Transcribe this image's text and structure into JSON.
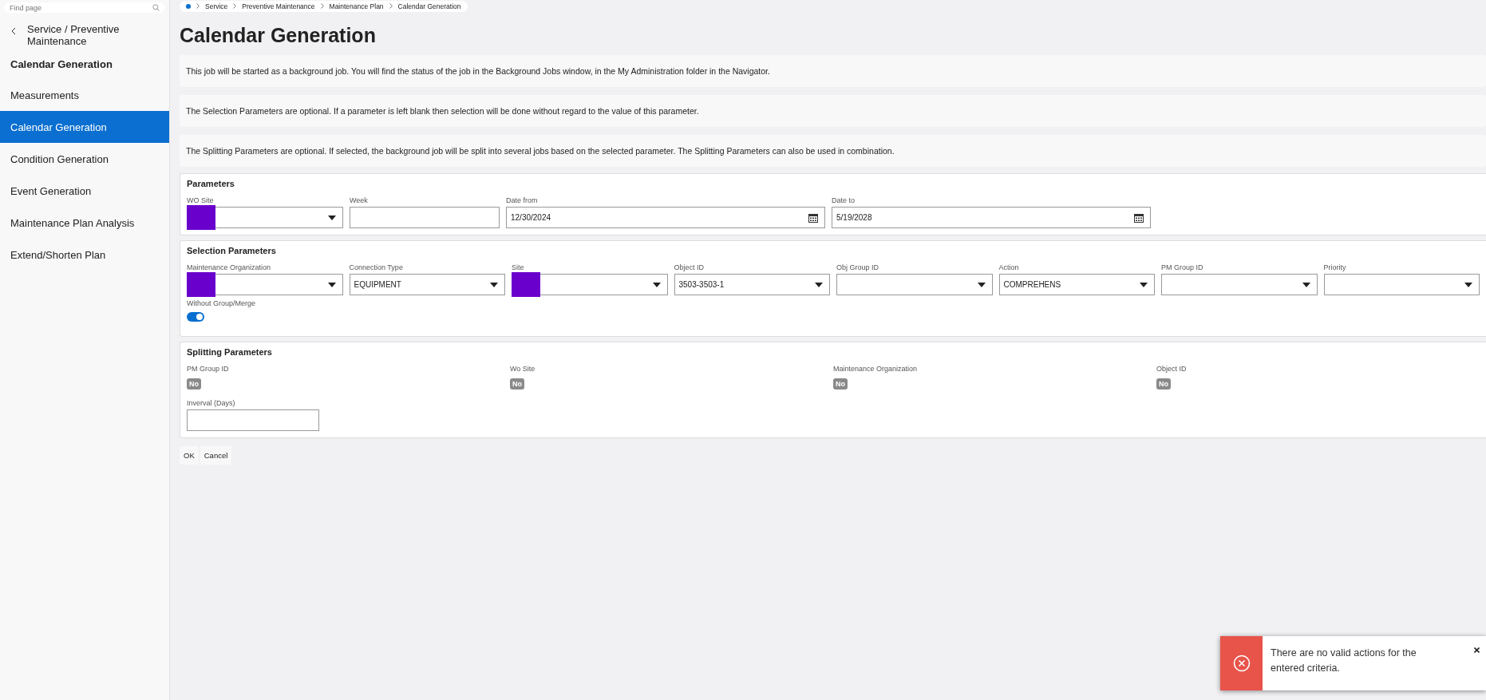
{
  "search": {
    "placeholder": "Find page"
  },
  "sidebar": {
    "back_title": "Service / Preventive Maintenance",
    "heading": "Calendar Generation",
    "items": [
      {
        "label": "Measurements",
        "selected": false
      },
      {
        "label": "Calendar Generation",
        "selected": true
      },
      {
        "label": "Condition Generation",
        "selected": false
      },
      {
        "label": "Event Generation",
        "selected": false
      },
      {
        "label": "Maintenance Plan Analysis",
        "selected": false
      },
      {
        "label": "Extend/Shorten Plan",
        "selected": false
      }
    ]
  },
  "breadcrumb": [
    "Service",
    "Preventive Maintenance",
    "Maintenance Plan",
    "Calendar Generation"
  ],
  "page_title": "Calendar Generation",
  "info_messages": [
    "This job will be started as a background job. You will find the status of the job in the Background Jobs window, in the My Administration folder in the Navigator.",
    "The Selection Parameters are optional. If a parameter is left blank then selection will be done without regard to the value of this parameter.",
    "The Splitting Parameters are optional. If selected, the background job will be split into several jobs based on the selected parameter. The Splitting Parameters can also be used in combination."
  ],
  "parameters": {
    "title": "Parameters",
    "fields": [
      {
        "label": "WO Site",
        "kind": "dropdown",
        "redacted": true
      },
      {
        "label": "Week",
        "kind": "text"
      },
      {
        "label": "Date from",
        "kind": "date",
        "value": "12/30/2024"
      },
      {
        "label": "Date to",
        "kind": "date",
        "value": "5/19/2028"
      }
    ]
  },
  "selection_parameters": {
    "title": "Selection Parameters",
    "fields": [
      {
        "label": "Maintenance Organization",
        "kind": "dropdown",
        "redacted": true
      },
      {
        "label": "Connection Type",
        "kind": "dropdown",
        "value": "EQUIPMENT"
      },
      {
        "label": "Site",
        "kind": "dropdown",
        "redacted": true
      },
      {
        "label": "Object ID",
        "kind": "dropdown",
        "value": "3503-3503-1"
      },
      {
        "label": "Obj Group ID",
        "kind": "dropdown"
      },
      {
        "label": "Action",
        "kind": "dropdown",
        "value": "COMPREHENS"
      },
      {
        "label": "PM Group ID",
        "kind": "dropdown"
      },
      {
        "label": "Priority",
        "kind": "dropdown"
      }
    ],
    "toggle": {
      "label": "Without Group/Merge",
      "on": true
    }
  },
  "splitting_parameters": {
    "title": "Splitting Parameters",
    "switches": [
      {
        "label": "PM Group ID",
        "text": "No",
        "on": false
      },
      {
        "label": "Wo Site",
        "text": "No",
        "on": false
      },
      {
        "label": "Maintenance Organization",
        "text": "No",
        "on": false
      },
      {
        "label": "Object ID",
        "text": "No",
        "on": false
      }
    ],
    "interval": {
      "label": "Inverval (Days)"
    }
  },
  "buttons": [
    "OK",
    "Cancel"
  ],
  "toast": {
    "kind": "error",
    "message": "There are no valid actions for the entered criteria."
  }
}
